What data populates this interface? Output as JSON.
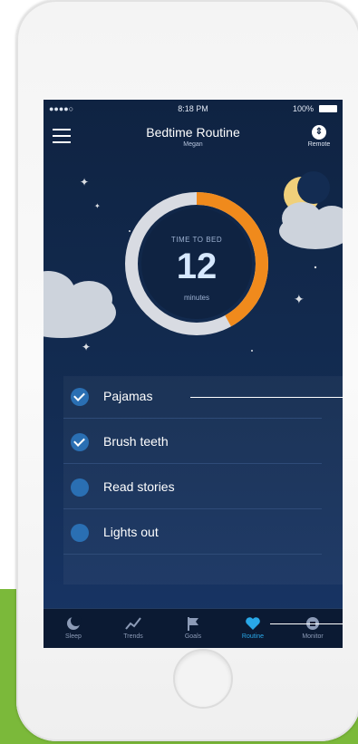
{
  "status_bar": {
    "signal": "●●●●○",
    "time": "8:18 PM",
    "battery": "100%"
  },
  "header": {
    "title": "Bedtime Routine",
    "subtitle": "Megan",
    "remote_label": "Remote"
  },
  "timer": {
    "label": "TIME TO BED",
    "value": "12",
    "unit": "minutes",
    "progress": 0.42,
    "colors": {
      "progress": "#f08a1c",
      "track": "#d8dbe2"
    }
  },
  "checklist": [
    {
      "label": "Pajamas",
      "done": true
    },
    {
      "label": "Brush teeth",
      "done": true
    },
    {
      "label": "Read stories",
      "done": false
    },
    {
      "label": "Lights out",
      "done": false
    }
  ],
  "tabs": [
    {
      "label": "Sleep",
      "icon": "moon-icon"
    },
    {
      "label": "Trends",
      "icon": "trend-icon"
    },
    {
      "label": "Goals",
      "icon": "flag-icon"
    },
    {
      "label": "Routine",
      "icon": "heart-icon",
      "active": true
    },
    {
      "label": "Monitor",
      "icon": "monitor-icon"
    }
  ],
  "colors": {
    "accent": "#29a8e8",
    "background": "#132c52",
    "brand_green": "#7bb93a"
  }
}
